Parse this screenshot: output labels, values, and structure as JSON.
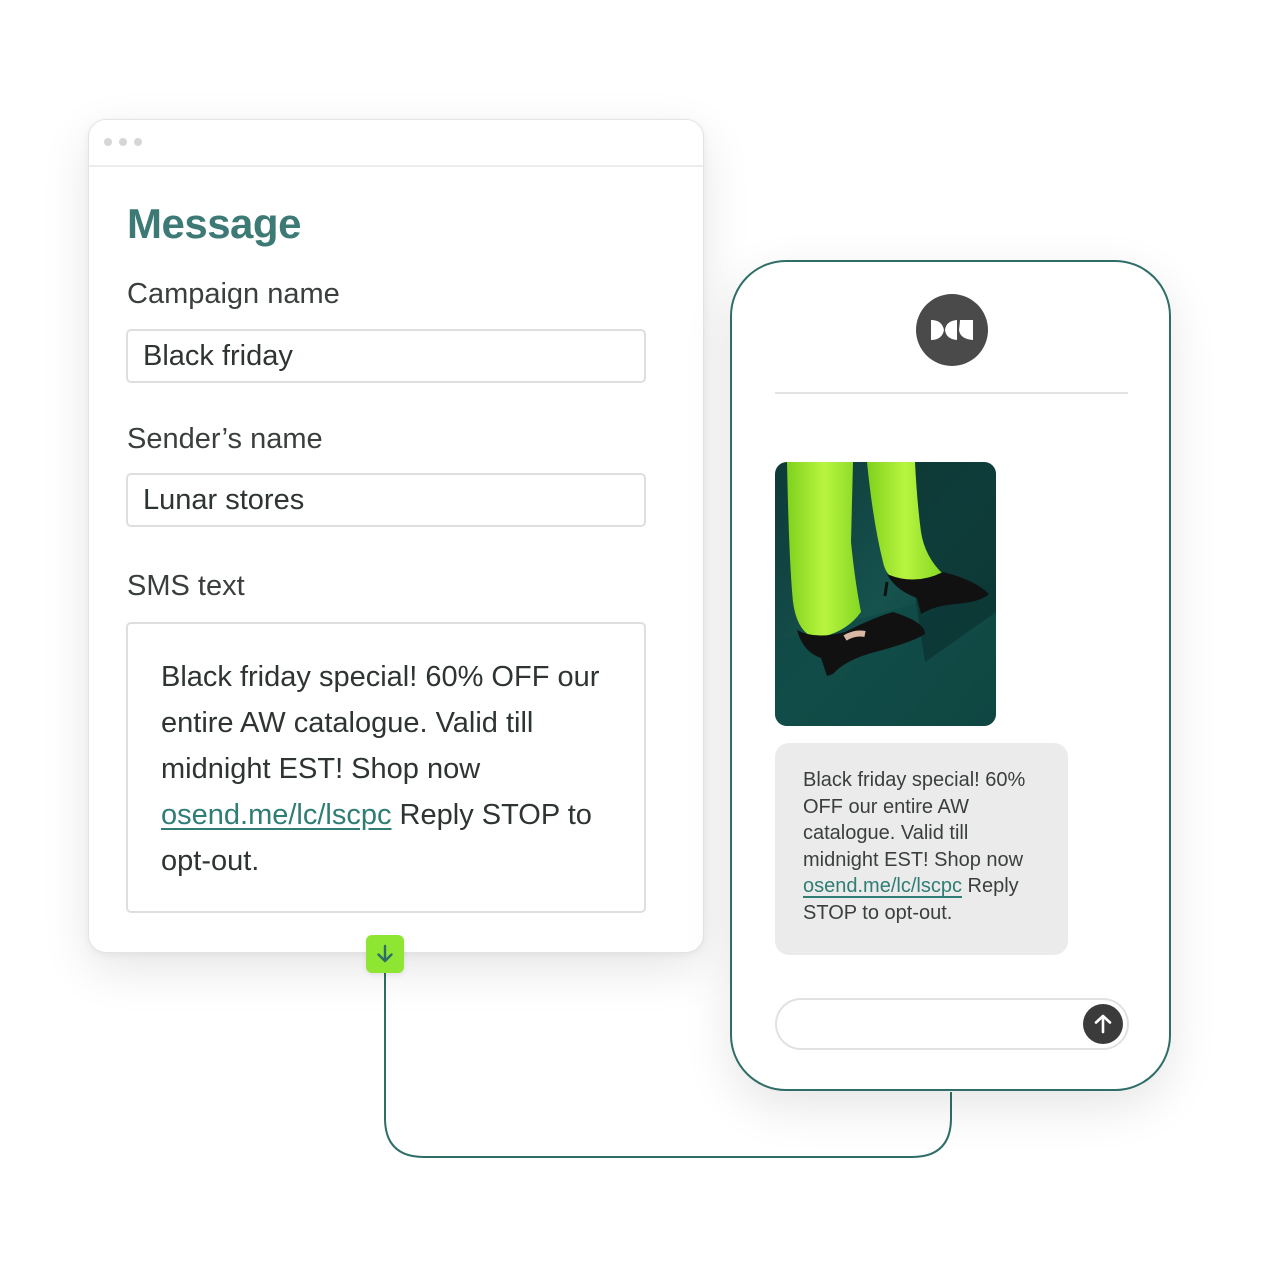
{
  "editor": {
    "title": "Message",
    "campaign": {
      "label": "Campaign name",
      "value": "Black friday"
    },
    "sender": {
      "label": "Sender’s name",
      "value": "Lunar stores"
    },
    "sms": {
      "label": "SMS text",
      "text_before_link": "Black friday special! 60% OFF our entire AW catalogue. Valid till midnight EST! Shop now ",
      "link": "osend.me/lc/lscpc",
      "text_after_link": " Reply STOP to opt-out."
    }
  },
  "phone": {
    "message": {
      "text_before_link": "Black friday special! 60% OFF our entire AW catalogue. Valid till midnight EST! Shop now ",
      "link": "osend.me/lc/lscpc",
      "text_after_link": " Reply STOP to opt-out."
    },
    "compose_placeholder": ""
  },
  "icons": {
    "down": "arrow-down-icon",
    "send": "arrow-up-icon",
    "avatar": "brand-logo-icon"
  },
  "colors": {
    "heading": "#3d7a75",
    "accent_green": "#8ee532",
    "phone_border": "#2f6e68",
    "link": "#2f7d74"
  }
}
